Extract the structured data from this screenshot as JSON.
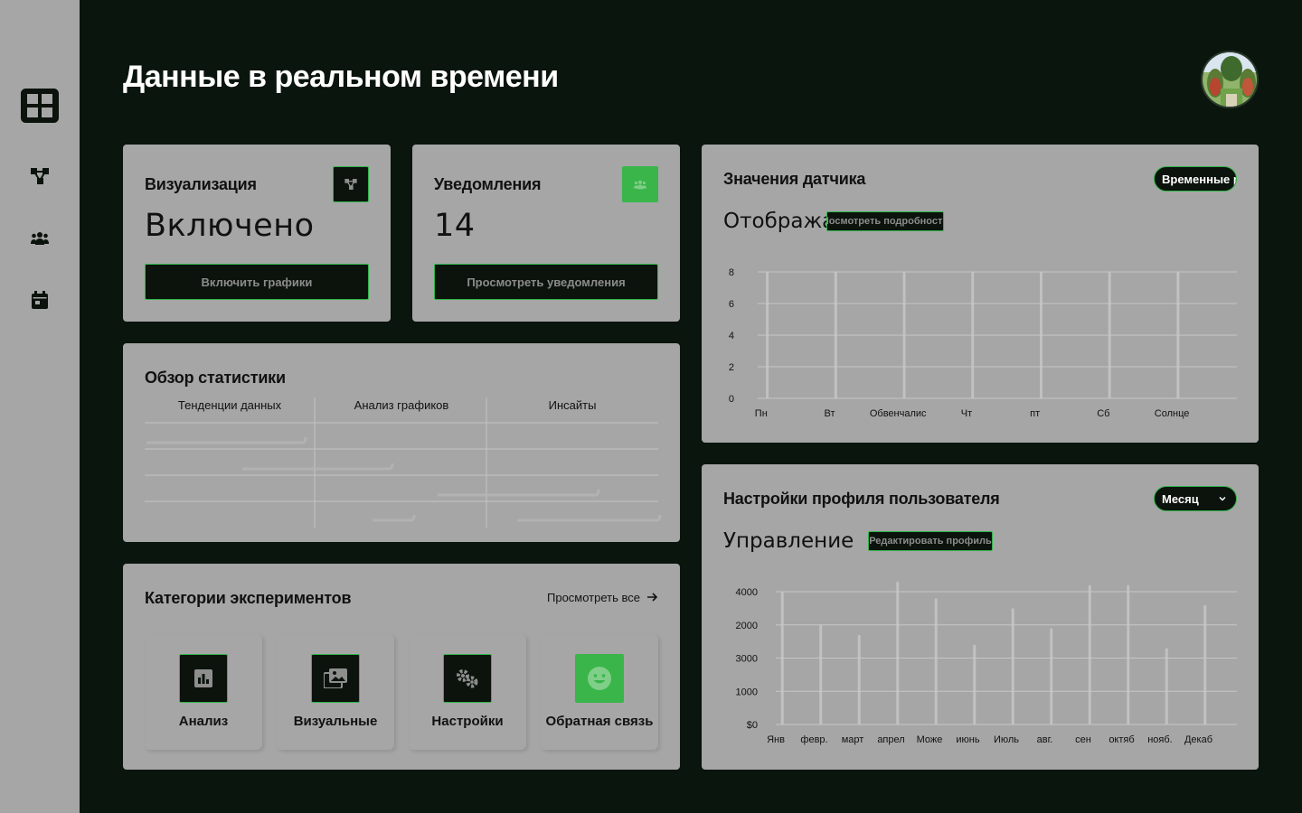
{
  "page": {
    "title": "Данные в реальном времени"
  },
  "sidebar": {
    "items": [
      {
        "icon": "dashboard-grid-icon"
      },
      {
        "icon": "graph-nodes-icon"
      },
      {
        "icon": "users-group-icon"
      },
      {
        "icon": "calendar-icon"
      }
    ]
  },
  "colors": {
    "accent": "#3ab54a",
    "background": "#0a150d",
    "card": "#a6a6a6",
    "button": "#0b130c"
  },
  "visualization_card": {
    "title": "Визуализация",
    "value": "Включено",
    "button": "Включить графики",
    "icon": "graph-nodes-icon"
  },
  "notifications_card": {
    "title": "Уведомления",
    "value": "14",
    "button": "Просмотреть уведомления",
    "icon": "users-group-icon"
  },
  "stats_card": {
    "title": "Обзор статистики",
    "columns": [
      "Тенденции данных",
      "Анализ графиков",
      "Инсайты"
    ]
  },
  "categories_card": {
    "title": "Категории экспериментов",
    "view_all": "Просмотреть все",
    "items": [
      {
        "label": "Анализ",
        "icon": "bar-chart-icon"
      },
      {
        "label": "Визуальные",
        "icon": "image-gallery-icon"
      },
      {
        "label": "Настройки",
        "icon": "gears-icon"
      },
      {
        "label": "Обратная связь",
        "icon": "smile-icon"
      }
    ]
  },
  "sensor_card": {
    "title": "Значения датчика",
    "pill": "Временные ра",
    "subtitle": "Отобража",
    "details_button": "Посмотреть подробности"
  },
  "profile_card": {
    "title": "Настройки профиля пользователя",
    "dropdown": "Месяц",
    "subtitle": "Управление",
    "edit_button": "Редактировать профиль"
  },
  "chart_data": [
    {
      "type": "bar",
      "title": "Значения датчика",
      "categories": [
        "Пн",
        "Вт",
        "Обвенчалис",
        "Чт",
        "пт",
        "Сб",
        "Солнце"
      ],
      "yticks": [
        "0",
        "2",
        "4",
        "6",
        "8"
      ],
      "ylim": [
        0,
        8
      ],
      "values": [
        8,
        8,
        8,
        8,
        8,
        8,
        8
      ],
      "grid": true
    },
    {
      "type": "bar",
      "title": "Настройки профиля пользователя",
      "categories": [
        "Янв",
        "февр.",
        "март",
        "апрел",
        "Може",
        "июнь",
        "Июль",
        "авг.",
        "сен",
        "октяб",
        "нояб.",
        "Декаб"
      ],
      "yticks": [
        "$0",
        "1000",
        "3000",
        "2000",
        "4000"
      ],
      "ylim": [
        0,
        4000
      ],
      "values": [
        4000,
        3000,
        2700,
        4300,
        3800,
        2400,
        3500,
        2900,
        4200,
        4200,
        2300,
        3600
      ],
      "grid": true
    }
  ]
}
